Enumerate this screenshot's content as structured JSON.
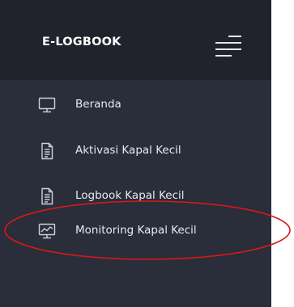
{
  "sidebar": {
    "brand": "E-LOGBOOK",
    "toggle_icon": "hamburger-menu-icon",
    "items": [
      {
        "label": "Beranda",
        "icon": "monitor-icon"
      },
      {
        "label": "Aktivasi Kapal Kecil",
        "icon": "document-icon"
      },
      {
        "label": "Logbook Kapal Kecil",
        "icon": "document-icon"
      },
      {
        "label": "Monitoring Kapal Kecil",
        "icon": "monitor-chart-icon"
      }
    ]
  },
  "colors": {
    "sidebar_bg": "#2a2d3a",
    "header_bg": "#21232c",
    "text": "#e9eaf0",
    "highlight_ellipse": "#d81919"
  }
}
